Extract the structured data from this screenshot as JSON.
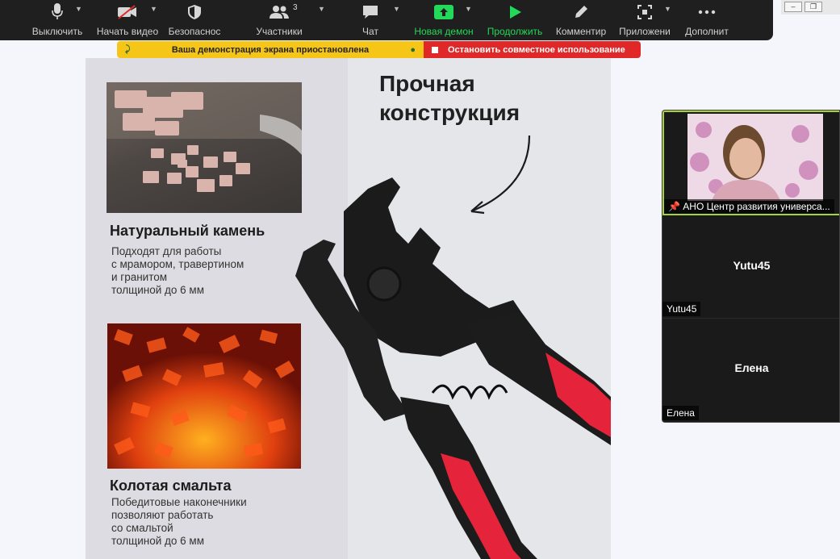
{
  "toolbar": {
    "mute_label": "Выключить",
    "video_label": "Начать видео",
    "security_label": "Безопаснос",
    "participants_label": "Участники",
    "participants_count": "3",
    "chat_label": "Чат",
    "new_share_label": "Новая демон",
    "resume_label": "Продолжить",
    "annotate_label": "Комментир",
    "apps_label": "Приложени",
    "more_label": "Дополнит"
  },
  "banner": {
    "paused_text": "Ваша демонстрация экрана приостановлена",
    "stop_text": "Остановить совместное использование"
  },
  "slide": {
    "title": "Прочная\nконструкция",
    "natural_heading": "Натуральный камень",
    "natural_desc": "Подходят для работы\nс мрамором, травертином\nи гранитом\nтолщиной до 6 мм",
    "smalt_heading": "Колотая смальта",
    "smalt_desc": "Победитовые наконечники\nпозволяют работать\nсо смальтой\nтолщиной до 6 мм"
  },
  "gallery": {
    "participant1_name": "АНО Центр развития универса...",
    "participant2_name": "Yutu45",
    "participant3_name": "Елена"
  },
  "colors": {
    "toolbar_bg": "#1f1f1f",
    "active_green": "#23d959",
    "banner_yellow": "#f5c518",
    "banner_red": "#e02828",
    "speaker_border": "#a6d23c",
    "plier_red": "#e5243b"
  }
}
